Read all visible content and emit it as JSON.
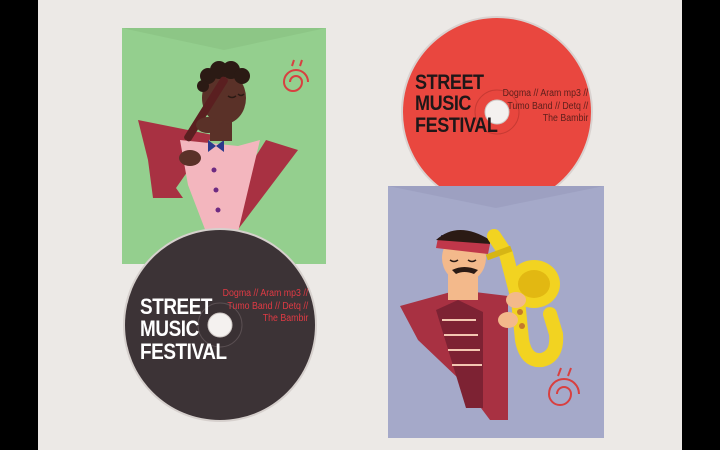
{
  "colors": {
    "background": "#ece9e6",
    "frame": "#000000",
    "green_sleeve": "#94cf8e",
    "blue_sleeve": "#a5a9c9",
    "red_disc": "#e9473f",
    "dark_disc": "#3c3336",
    "maroon": "#a83142",
    "pink": "#f3b6be",
    "brass": "#f2d321",
    "disc_title_red": "#1e1718",
    "disc_title_dark": "#ffffff",
    "disc_bands_red": "#5c1f1b",
    "disc_bands_dark": "#e03a44"
  },
  "red_disc": {
    "title": [
      "STREET",
      "MUSIC",
      "FESTIVAL"
    ],
    "bands": [
      "Dogma // Aram mp3 //",
      "Tumo Band // Detq //",
      "The Bambir"
    ]
  },
  "dark_disc": {
    "title": [
      "STREET",
      "MUSIC",
      "FESTIVAL"
    ],
    "bands": [
      "Dogma // Aram mp3 //",
      "Tumo Band // Detq //",
      "The Bambir"
    ]
  },
  "illustrations": {
    "green_sleeve": "flute-player-illustration",
    "blue_sleeve": "saxophone-player-illustration",
    "ornaments": [
      "swirl-ornament-icon",
      "swirl-ornament-icon"
    ]
  }
}
